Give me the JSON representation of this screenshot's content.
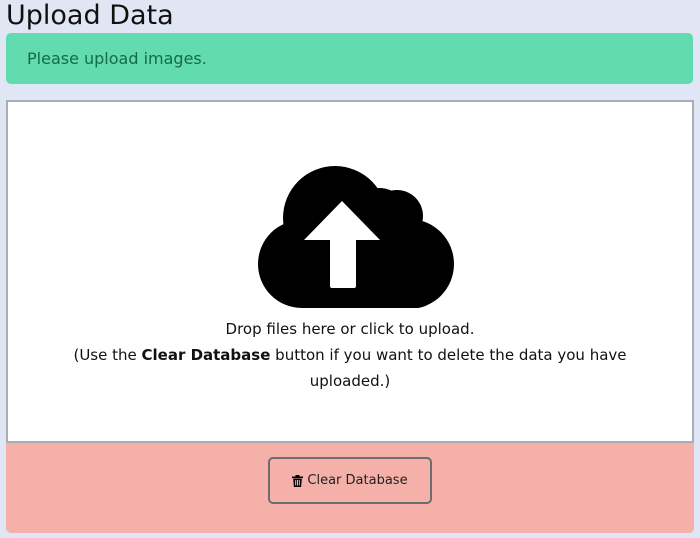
{
  "page": {
    "title": "Upload Data"
  },
  "alert": {
    "message": "Please upload images."
  },
  "dropzone": {
    "icon": "cloud-upload-icon",
    "line1": "Drop files here or click to upload.",
    "hint_prefix": "(Use the ",
    "hint_bold": "Clear Database",
    "hint_suffix": " button if you want to delete the data you have uploaded.)"
  },
  "clear_button": {
    "label": "Clear Database",
    "icon": "trash-icon"
  },
  "colors": {
    "background": "#e1e6f5",
    "alert_bg": "#61dbaf",
    "alert_text": "#156a4b",
    "danger_bg": "#f4b0a9"
  }
}
